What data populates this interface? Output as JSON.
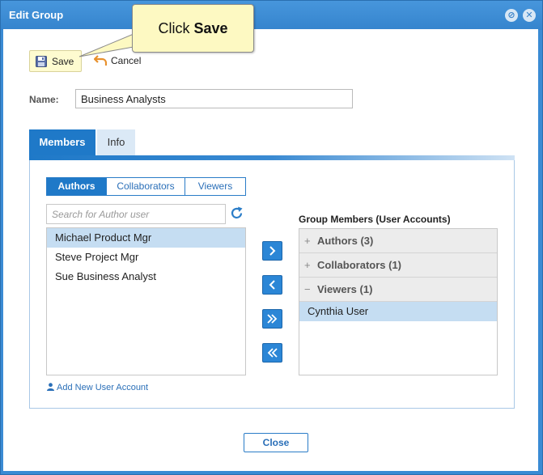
{
  "window": {
    "title": "Edit Group"
  },
  "callout": {
    "prefix": "Click",
    "emphasis": "Save"
  },
  "toolbar": {
    "save_label": "Save",
    "cancel_label": "Cancel"
  },
  "name": {
    "label": "Name:",
    "value": "Business Analysts"
  },
  "tabs": [
    {
      "label": "Members",
      "active": true
    },
    {
      "label": "Info",
      "active": false
    }
  ],
  "subtabs": [
    {
      "label": "Authors",
      "active": true
    },
    {
      "label": "Collaborators",
      "active": false
    },
    {
      "label": "Viewers",
      "active": false
    }
  ],
  "search": {
    "placeholder": "Search for Author user",
    "value": ""
  },
  "users": [
    {
      "name": "Michael Product Mgr",
      "selected": true
    },
    {
      "name": "Steve Project Mgr",
      "selected": false
    },
    {
      "name": "Sue Business Analyst",
      "selected": false
    }
  ],
  "add_user_label": "Add New User Account",
  "group_members": {
    "heading": "Group Members (User Accounts)",
    "groups": [
      {
        "label": "Authors (3)",
        "expanded": false,
        "toggle": "+"
      },
      {
        "label": "Collaborators (1)",
        "expanded": false,
        "toggle": "+"
      },
      {
        "label": "Viewers (1)",
        "expanded": true,
        "toggle": "−"
      }
    ],
    "viewers_members": [
      "Cynthia User"
    ]
  },
  "footer": {
    "close_label": "Close"
  },
  "colors": {
    "accent": "#1f79c8",
    "titlebar": "#3a8bd4",
    "selected_row": "#c5ddf2",
    "callout_bg": "#fdf9c2",
    "save_bg": "#fefbd0"
  },
  "icons": [
    "floppy-disk-icon",
    "undo-arrow-icon",
    "refresh-icon",
    "user-icon",
    "minimize-icon",
    "close-icon",
    "chevron-right-icon",
    "chevron-left-icon",
    "double-chevron-right-icon",
    "double-chevron-left-icon"
  ]
}
